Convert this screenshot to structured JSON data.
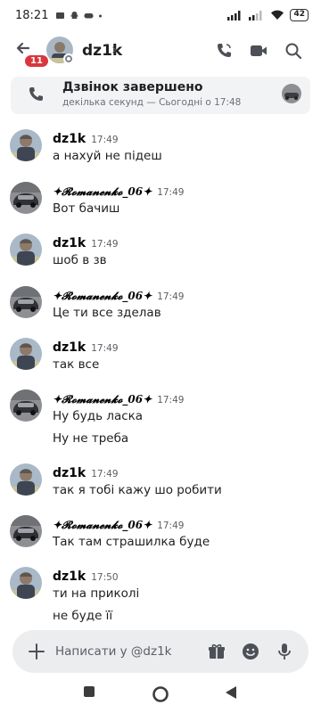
{
  "statusbar": {
    "time": "18:21",
    "battery": "42"
  },
  "header": {
    "back_badge": "11",
    "name": "dz1k",
    "chevron": "›"
  },
  "call": {
    "title": "Дзвінок завершено",
    "subtitle": "декілька секунд — Сьогодні о 17:48"
  },
  "messages": [
    {
      "author": "dz1k",
      "time": "17:49",
      "lines": [
        "а нахуй не підеш"
      ],
      "fancy": false
    },
    {
      "author": "✦𝓡𝓸𝓶𝓪𝓷𝓮𝓷𝓴𝓸_06✦",
      "time": "17:49",
      "lines": [
        "Вот бачиш"
      ],
      "fancy": true
    },
    {
      "author": "dz1k",
      "time": "17:49",
      "lines": [
        "шоб в зв"
      ],
      "fancy": false
    },
    {
      "author": "✦𝓡𝓸𝓶𝓪𝓷𝓮𝓷𝓴𝓸_06✦",
      "time": "17:49",
      "lines": [
        "Це ти все зделав"
      ],
      "fancy": true
    },
    {
      "author": "dz1k",
      "time": "17:49",
      "lines": [
        "так все"
      ],
      "fancy": false
    },
    {
      "author": "✦𝓡𝓸𝓶𝓪𝓷𝓮𝓷𝓴𝓸_06✦",
      "time": "17:49",
      "lines": [
        "Ну будь ласка",
        "Ну не треба"
      ],
      "fancy": true
    },
    {
      "author": "dz1k",
      "time": "17:49",
      "lines": [
        "так я тобі кажу шо робити"
      ],
      "fancy": false
    },
    {
      "author": "✦𝓡𝓸𝓶𝓪𝓷𝓮𝓷𝓴𝓸_06✦",
      "time": "17:49",
      "lines": [
        "Так там страшилка буде"
      ],
      "fancy": true
    },
    {
      "author": "dz1k",
      "time": "17:50",
      "lines": [
        "ти на приколі",
        "не буде її"
      ],
      "fancy": false
    }
  ],
  "composer": {
    "placeholder": "Написати у @dz1k"
  },
  "icons": [
    "back-arrow-icon",
    "voice-call-icon",
    "video-call-icon",
    "search-icon",
    "phone-icon",
    "plus-icon",
    "gift-icon",
    "emoji-icon",
    "microphone-icon"
  ]
}
